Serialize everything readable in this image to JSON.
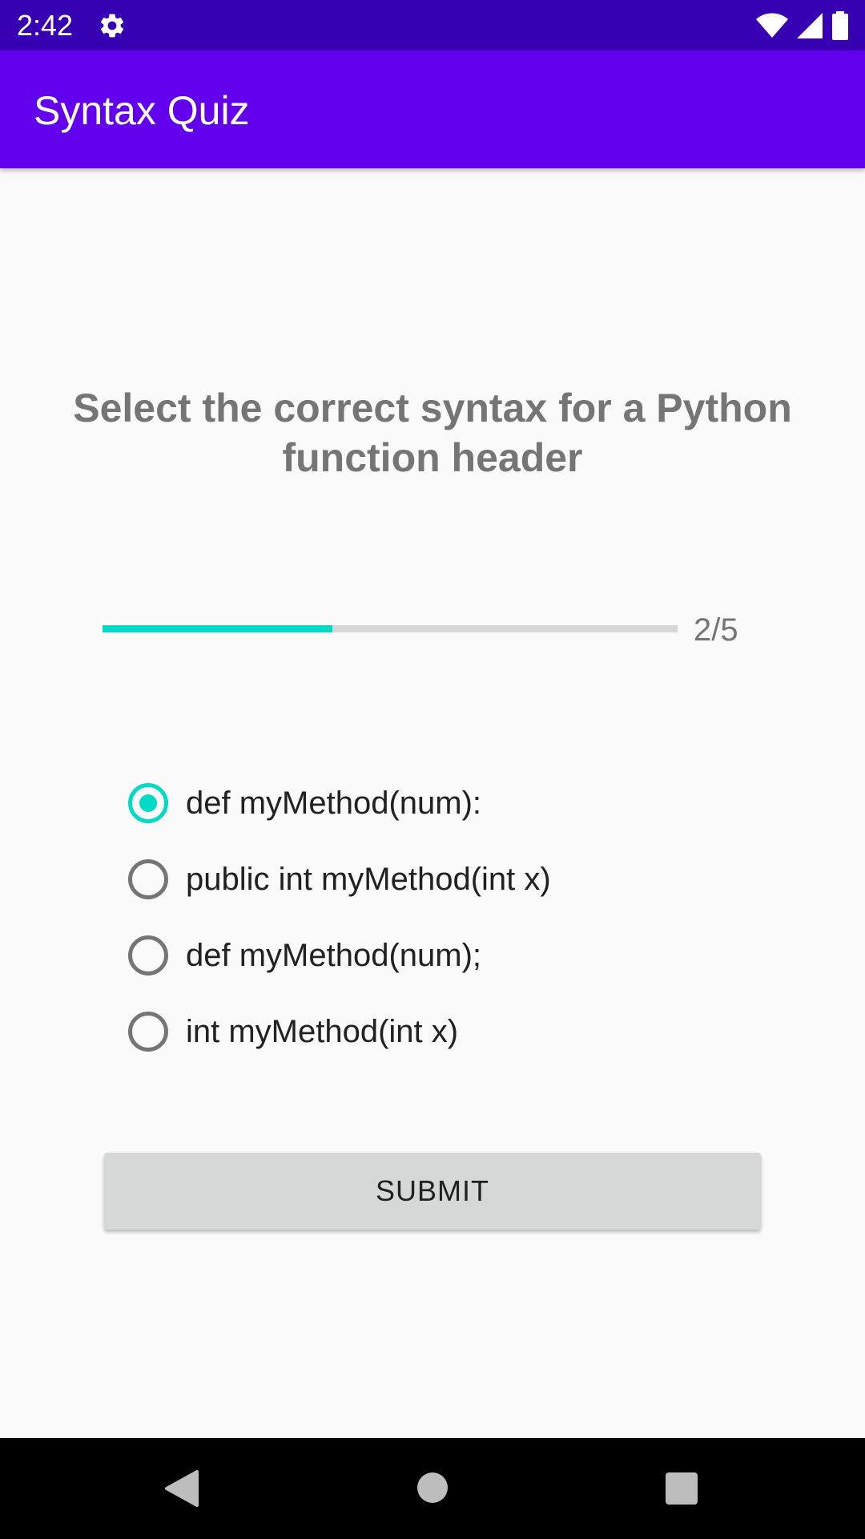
{
  "status_bar": {
    "time": "2:42",
    "icons": [
      "gear-icon",
      "wifi-icon",
      "cell-signal-icon",
      "battery-icon"
    ]
  },
  "app_bar": {
    "title": "Syntax Quiz"
  },
  "quiz": {
    "question": "Select the correct syntax for a Python function header",
    "progress": {
      "current": 2,
      "total": 5,
      "fraction": 0.4,
      "label": "2/5"
    },
    "options": [
      {
        "label": "def myMethod(num):",
        "checked": true
      },
      {
        "label": "public int myMethod(int x)",
        "checked": false
      },
      {
        "label": "def myMethod(num);",
        "checked": false
      },
      {
        "label": "int myMethod(int x)",
        "checked": false
      }
    ],
    "submit_label": "SUBMIT"
  },
  "nav_bar": {
    "icons": [
      "back-icon",
      "home-icon",
      "recent-apps-icon"
    ]
  },
  "colors": {
    "status_bar": "#3700b3",
    "app_bar": "#6200ee",
    "accent": "#03dac5",
    "background": "#fafafa"
  }
}
